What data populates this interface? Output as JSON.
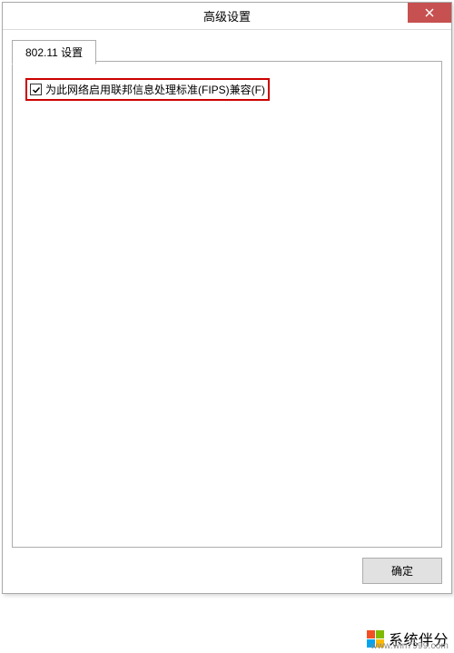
{
  "dialog": {
    "title": "高级设置"
  },
  "tabs": {
    "tab1": "802.11 设置"
  },
  "panel": {
    "fips_checkbox_label": "为此网络启用联邦信息处理标准(FIPS)兼容(F)",
    "fips_checked": true
  },
  "footer": {
    "ok_label": "确定"
  },
  "watermark": {
    "brand": "系统伴分",
    "url": "www.win7999.com"
  }
}
